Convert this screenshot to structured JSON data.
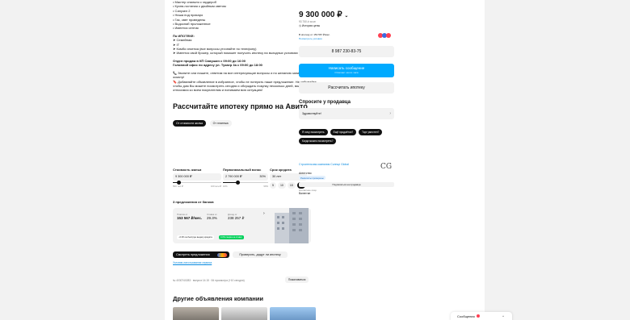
{
  "description": {
    "bullets": [
      "• Мастер спальня с гардероб",
      "• Кухня-гостиная с двойным светом",
      "• Санузел 2",
      "• Ниша под прахаро",
      "• Газ, свет проведены",
      "• Водоснаб проложенное",
      "• Имеется септик"
    ],
    "mortgage_title": "По ИПОТЕКЕ:",
    "mortgage_items": [
      "➤ Семейная",
      "➤ IT",
      "➤ Комбо ипотека (все вопросы уточняйте по телефону)",
      "➤ Имеется свой брокер, который поможет получить ипотеку на выгодных условиях"
    ],
    "office_line1": "Отдел продаж в КП Самушин с 09:00 до 16:00",
    "office_line2": "Головной офис по адресу ул. Тукаер 3а с 09:00 до 18:00",
    "call_note": "📞 Звоните или пишите, ответим на все интересующие вопросы и по желанию запишем Вас на осмотр!",
    "fav_note": "🔖 Добавляйте объявление в избранное, чтобы не потерять наше предложение. Не забывайте, чтобы дом Вы можете посмотреть сегодня и обсуждать покупку несколько дней, мы охотно относимся ко всем покупателям и понимаем всю ситуацию!"
  },
  "calculator": {
    "title": "Рассчитайте ипотеку прямо на Авито",
    "tab_active": "От стоимости жилья",
    "tab_other": "От платежа",
    "price_label": "Стоимость жилья",
    "price_value": "9 300 000 ₽",
    "price_min": "500 тыс ₽",
    "price_max": "100 млн ₽",
    "down_label": "Первоначальный взнос",
    "down_value": "2 790 000 ₽",
    "down_pct": "30%",
    "down_min": "10%",
    "down_max": "99%",
    "term_label": "Срок кредита",
    "term_value": "30 лет",
    "term_options": [
      "5",
      "10",
      "15",
      "20"
    ],
    "offers_count": "3 предложения от банков",
    "offer": {
      "payment_label": "Платёж от",
      "payment": "153 567 ₽/мес.",
      "rate_label": "Ставка от",
      "rate": "29.3%",
      "income_label": "Доход от",
      "income": "238 257 ₽",
      "tag1": "−0.3% за быструю выдачу кредита",
      "tag2": "0.3% скидка на ставку"
    },
    "cta": "Смотреть предложения",
    "check": "Проверить, дадут ли ипотеку",
    "terms_link": "Условия использования сервиса"
  },
  "footer": {
    "meta": "№ 4030740283 · вчера в 14:15 · 84 просмотра (+10 сегодня)",
    "report": "Пожаловаться"
  },
  "other_title": "Другие объявления компании",
  "sidebar": {
    "price": "9 300 000 ₽",
    "price_per": "93 750 ₽ за м²",
    "history": "История цены",
    "mortgage_line": "В ипотеку от 153 567 ₽/мес.",
    "mortgage_link": "Посмотреть условия",
    "phone": "8 987 230-83-75",
    "message": "Написать сообщение",
    "message_sub": "Отвечает около часа",
    "calc_btn": "Рассчитать ипотеку",
    "ask_title": "Спросите у продавца",
    "ask_placeholder": "Здравствуйте!",
    "quick": [
      "Я хочу посмотреть",
      "Ещё продаётся?",
      "Торг уместен?",
      "Когда можно посмотреть?"
    ],
    "company_name": "Строительная компания Солнце Global",
    "company_type": "Агентство",
    "company_badge": "Реквизиты проверены",
    "subscribe": "Подписаться на продавца",
    "contact_label": "Контактное лицо",
    "contact_name": "Валентин",
    "logo_text": "CG"
  },
  "chat_widget": {
    "label": "Сообщения"
  },
  "colors": {
    "accent_blue": "#00aaff",
    "green": "#02d15c",
    "red": "#ff4053"
  }
}
